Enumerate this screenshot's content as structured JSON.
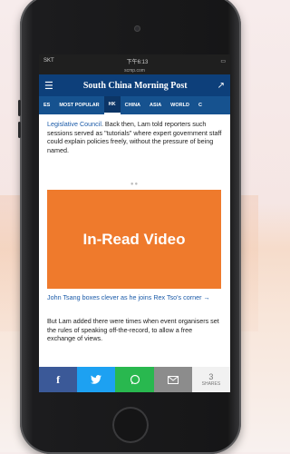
{
  "status_bar": {
    "carrier": "SKT",
    "time": "下午6:13"
  },
  "url": "scmp.com",
  "masthead": "South China Morning Post",
  "tabs": [
    "ES",
    "MOST POPULAR",
    "HK",
    "CHINA",
    "ASIA",
    "WORLD",
    "C"
  ],
  "active_tab": "HK",
  "article": {
    "para1_link": "Legislative Council",
    "para1_text": ". Back then, Lam told reporters such sessions served as \"tutorials\" where expert government staff could explain policies freely, without the pressure of being named.",
    "ad_label": "In-Read Video",
    "related_link": "John Tsang boxes clever as he joins Rex Tso's corner →",
    "para2_text": "But Lam added there were times when event organisers set the rules of speaking off-the-record, to allow a free exchange of views."
  },
  "share": {
    "count": "3",
    "count_label": "SHARES"
  },
  "colors": {
    "header": "#0d3f7a",
    "tabs": "#16528f",
    "ad": "#ef7a2c",
    "facebook": "#3b5998",
    "twitter": "#1da1f2",
    "whatsapp": "#29b84f",
    "email": "#8c8c8c"
  }
}
